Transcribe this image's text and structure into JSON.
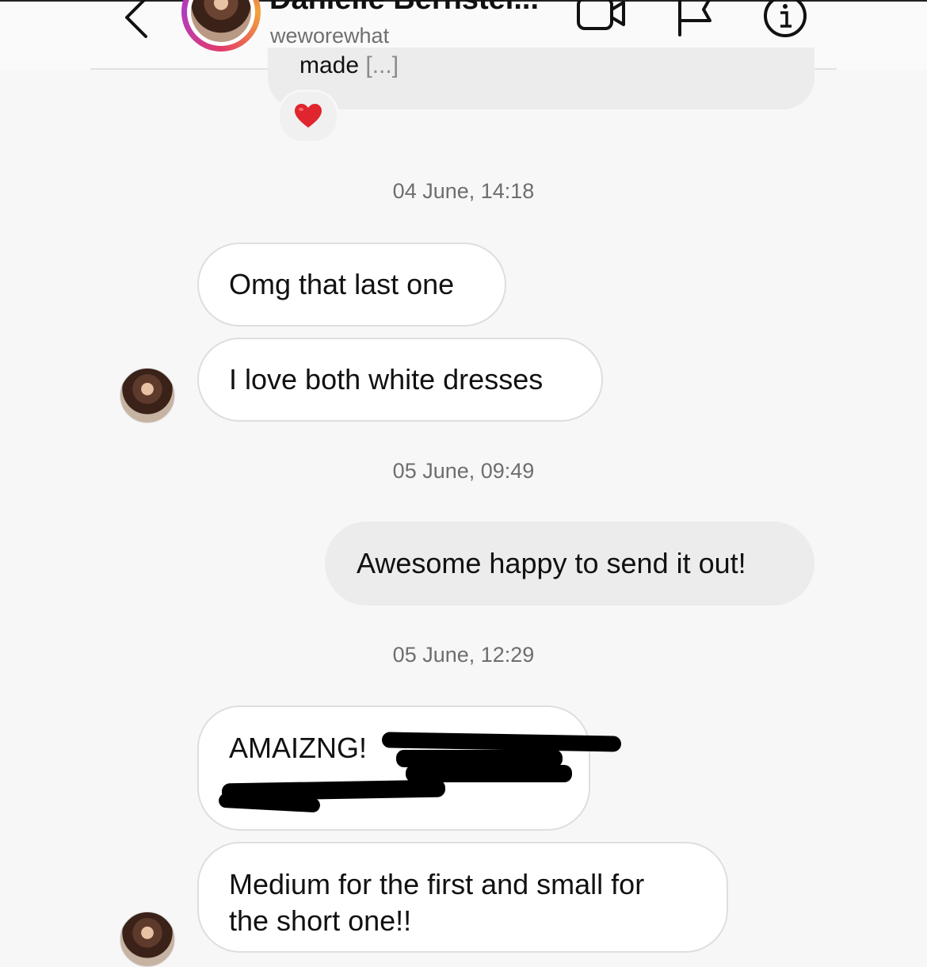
{
  "header": {
    "display_name": "Danielle Bernstei...",
    "username": "weworewhat",
    "icons": {
      "back": "chevron-left-icon",
      "video": "video-call-icon",
      "flag": "flag-icon",
      "info": "info-icon"
    }
  },
  "thread": {
    "previous_message": {
      "text": "made",
      "ellipsis": "[...]",
      "reaction": "❤️"
    },
    "groups": [
      {
        "timestamp": "04 June, 14:18",
        "messages": [
          {
            "direction": "in",
            "text": "Omg that last one"
          },
          {
            "direction": "in",
            "text": "I love both white dresses"
          }
        ]
      },
      {
        "timestamp": "05 June, 09:49",
        "messages": [
          {
            "direction": "out",
            "text": "Awesome happy to send it out!"
          }
        ]
      },
      {
        "timestamp": "05 June, 12:29",
        "messages": [
          {
            "direction": "in",
            "text": "AMAIZNG!",
            "redacted": true
          },
          {
            "direction": "in",
            "line1": "Medium for the first and small for",
            "line2": "the short one!!"
          }
        ]
      }
    ]
  },
  "colors": {
    "background": "#f7f7f7",
    "incoming_bubble": "#ffffff",
    "outgoing_bubble": "#ececec",
    "timestamp": "#6e6e6e",
    "reaction_heart": "#e0252e"
  }
}
